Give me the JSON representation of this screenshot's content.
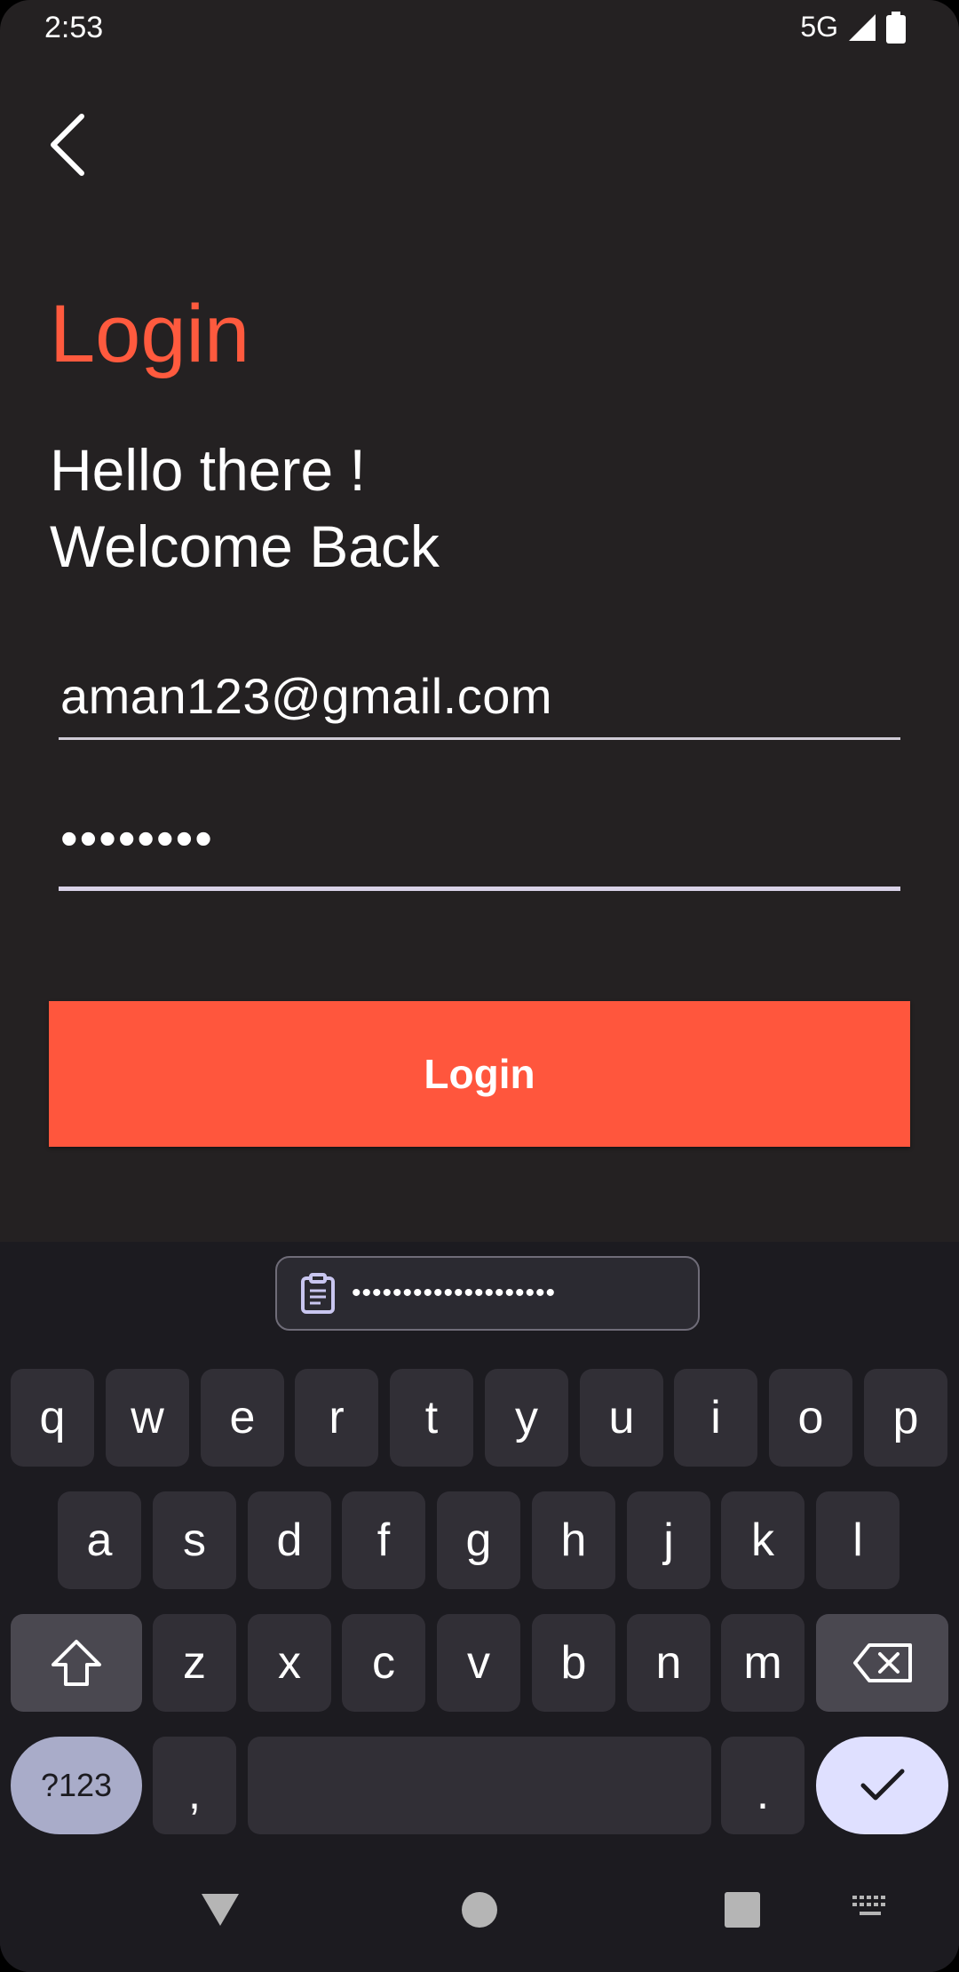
{
  "status_bar": {
    "time": "2:53",
    "network": "5G"
  },
  "header": {
    "title": "Login"
  },
  "greeting": {
    "line1": "Hello there !",
    "line2": "Welcome Back"
  },
  "form": {
    "email_value": "aman123@gmail.com",
    "password_value": "••••••••",
    "login_button": "Login"
  },
  "keyboard": {
    "clipboard_text": "••••••••••••••••••••",
    "row1": [
      "q",
      "w",
      "e",
      "r",
      "t",
      "y",
      "u",
      "i",
      "o",
      "p"
    ],
    "row2": [
      "a",
      "s",
      "d",
      "f",
      "g",
      "h",
      "j",
      "k",
      "l"
    ],
    "row3": [
      "z",
      "x",
      "c",
      "v",
      "b",
      "n",
      "m"
    ],
    "symbols_key": "?123",
    "comma_key": ",",
    "period_key": "."
  },
  "colors": {
    "accent": "#ff563d",
    "background": "#242122",
    "keyboard_bg": "#1c1b20"
  }
}
